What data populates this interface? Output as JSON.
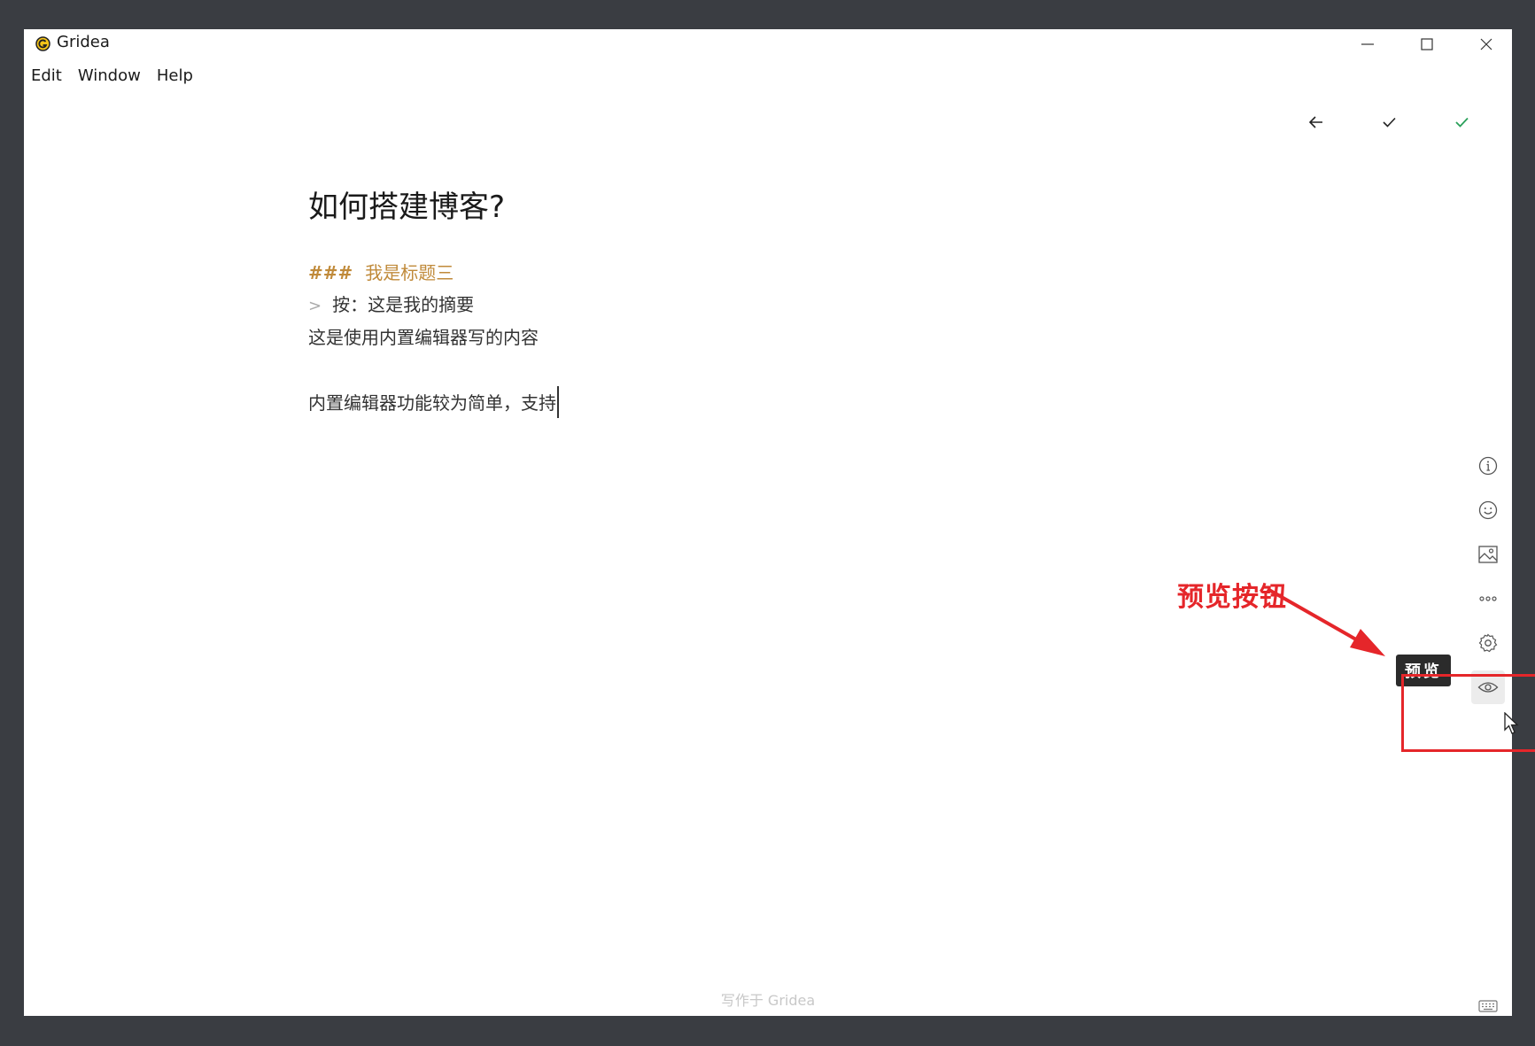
{
  "window": {
    "title": "Gridea"
  },
  "menu": {
    "items": [
      "Edit",
      "Window",
      "Help"
    ]
  },
  "editor": {
    "title": "如何搭建博客?",
    "heading_marker": "###",
    "heading_text": "我是标题三",
    "quote_marker": ">",
    "quote_text": "按：这是我的摘要",
    "body_line1": "这是使用内置编辑器写的内容",
    "body_line2": "内置编辑器功能较为简单，支持"
  },
  "tooltip": {
    "preview": "预览"
  },
  "footer": {
    "note": "写作于 Gridea"
  },
  "annotation": {
    "label": "预览按钮",
    "color": "#e5262a"
  },
  "colors": {
    "heading": "#c08a3a",
    "publish": "#2aa05a",
    "background": "#3a3d42"
  },
  "icons": {
    "top_actions": [
      "arrow-left-icon",
      "check-icon",
      "check-icon-green"
    ],
    "side_tools": [
      "info-icon",
      "emoji-icon",
      "image-icon",
      "more-icon",
      "gear-icon",
      "eye-icon",
      "keyboard-icon"
    ]
  }
}
